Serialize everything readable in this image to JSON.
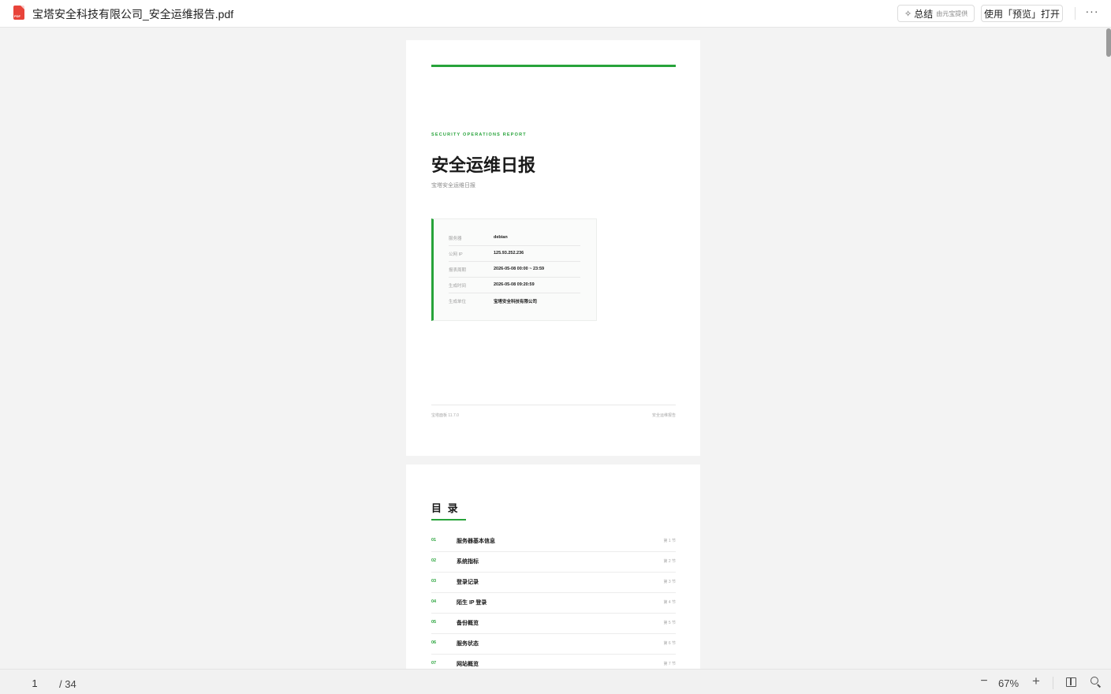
{
  "header": {
    "file_title": "宝塔安全科技有限公司_安全运维报告.pdf",
    "pdf_badge": "PDF",
    "summary_label": "总结",
    "summary_sub": "由元宝提供",
    "open_with_preview": "使用「预览」打开",
    "more": "···"
  },
  "page1": {
    "eyebrow": "SECURITY OPERATIONS REPORT",
    "title": "安全运维日报",
    "subtitle": "宝塔安全运维日报",
    "info": [
      {
        "key": "服务器",
        "value": "debian"
      },
      {
        "key": "公网 IP",
        "value": "125.93.252.236"
      },
      {
        "key": "报表周期",
        "value": "2026-05-08 00:00 ~ 23:59"
      },
      {
        "key": "生成时间",
        "value": "2026-05-08 09:20:59"
      },
      {
        "key": "生成单位",
        "value": "宝塔安全科技有限公司"
      }
    ],
    "footer_left": "宝塔面板 11.7.0",
    "footer_right": "安全运维报告"
  },
  "page2": {
    "toc_title": "目 录",
    "toc": [
      {
        "num": "01",
        "name": "服务器基本信息",
        "page": "第 1 节"
      },
      {
        "num": "02",
        "name": "系统指标",
        "page": "第 2 节"
      },
      {
        "num": "03",
        "name": "登录记录",
        "page": "第 3 节"
      },
      {
        "num": "04",
        "name": "陌生 IP 登录",
        "page": "第 4 节"
      },
      {
        "num": "05",
        "name": "备份概览",
        "page": "第 5 节"
      },
      {
        "num": "06",
        "name": "服务状态",
        "page": "第 6 节"
      },
      {
        "num": "07",
        "name": "网站概览",
        "page": "第 7 节"
      }
    ]
  },
  "footer": {
    "current_page": "1",
    "total_pages": "/ 34",
    "zoom_out": "−",
    "zoom": "67%",
    "zoom_in": "+"
  },
  "colors": {
    "accent": "#27a33a",
    "pdf_red": "#e8443a"
  }
}
